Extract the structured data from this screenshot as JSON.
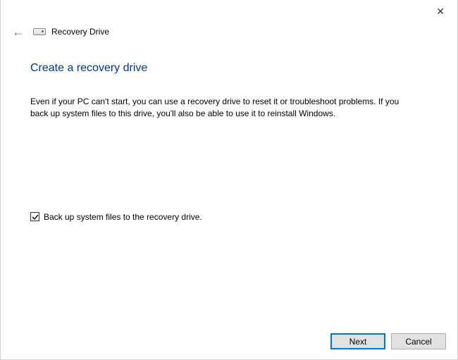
{
  "window": {
    "title": "Recovery Drive"
  },
  "heading": "Create a recovery drive",
  "body": "Even if your PC can't start, you can use a recovery drive to reset it or troubleshoot problems. If you back up system files to this drive, you'll also be able to use it to reinstall Windows.",
  "checkbox": {
    "label": "Back up system files to the recovery drive.",
    "checked": true
  },
  "buttons": {
    "next": "Next",
    "cancel": "Cancel"
  }
}
